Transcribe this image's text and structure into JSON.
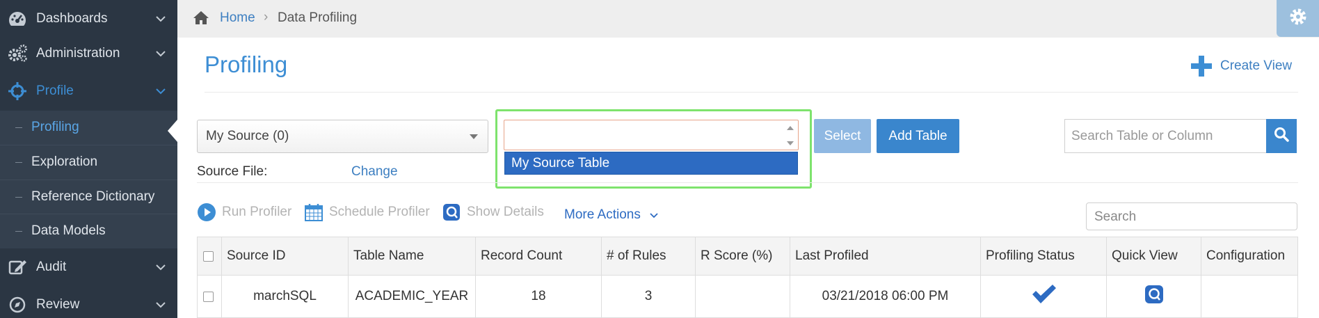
{
  "sidebar": {
    "items": [
      {
        "label": "Dashboards",
        "icon": "dashboard-icon"
      },
      {
        "label": "Administration",
        "icon": "gears-icon"
      },
      {
        "label": "Profile",
        "icon": "crosshair-icon"
      },
      {
        "label": "Audit",
        "icon": "edit-icon"
      },
      {
        "label": "Review",
        "icon": "compass-icon"
      }
    ],
    "submenu": [
      "Profiling",
      "Exploration",
      "Reference Dictionary",
      "Data Models"
    ]
  },
  "breadcrumb": {
    "home": "Home",
    "separator": "›",
    "current": "Data Profiling"
  },
  "page": {
    "title": "Profiling",
    "create_view": "Create View"
  },
  "controls": {
    "source_select": "My Source (0)",
    "table_input_value": "",
    "dropdown_option": "My Source Table",
    "select_button": "Select",
    "add_table_button": "Add Table",
    "search_table_placeholder": "Search Table or Column",
    "source_file_label": "Source File:",
    "change_link": "Change"
  },
  "actions": {
    "run_profiler": "Run Profiler",
    "schedule_profiler": "Schedule Profiler",
    "show_details": "Show Details",
    "more_actions": "More Actions",
    "search_placeholder": "Search"
  },
  "table": {
    "columns": [
      "Source ID",
      "Table Name",
      "Record Count",
      "# of Rules",
      "R Score (%)",
      "Last Profiled",
      "Profiling Status",
      "Quick View",
      "Configuration"
    ],
    "rows": [
      {
        "source_id": "marchSQL",
        "table_name": "ACADEMIC_YEAR",
        "record_count": "18",
        "rules": "3",
        "r_score": "",
        "last_profiled": "03/21/2018 06:00 PM",
        "status_icon": "checkmark-icon",
        "quick_view_icon": "quick-view-icon",
        "configuration": ""
      }
    ]
  },
  "colors": {
    "sidebar_bg": "#2b3643",
    "accent": "#3d8ed4",
    "highlight": "#7ee36d",
    "button": "#3a86cd"
  }
}
